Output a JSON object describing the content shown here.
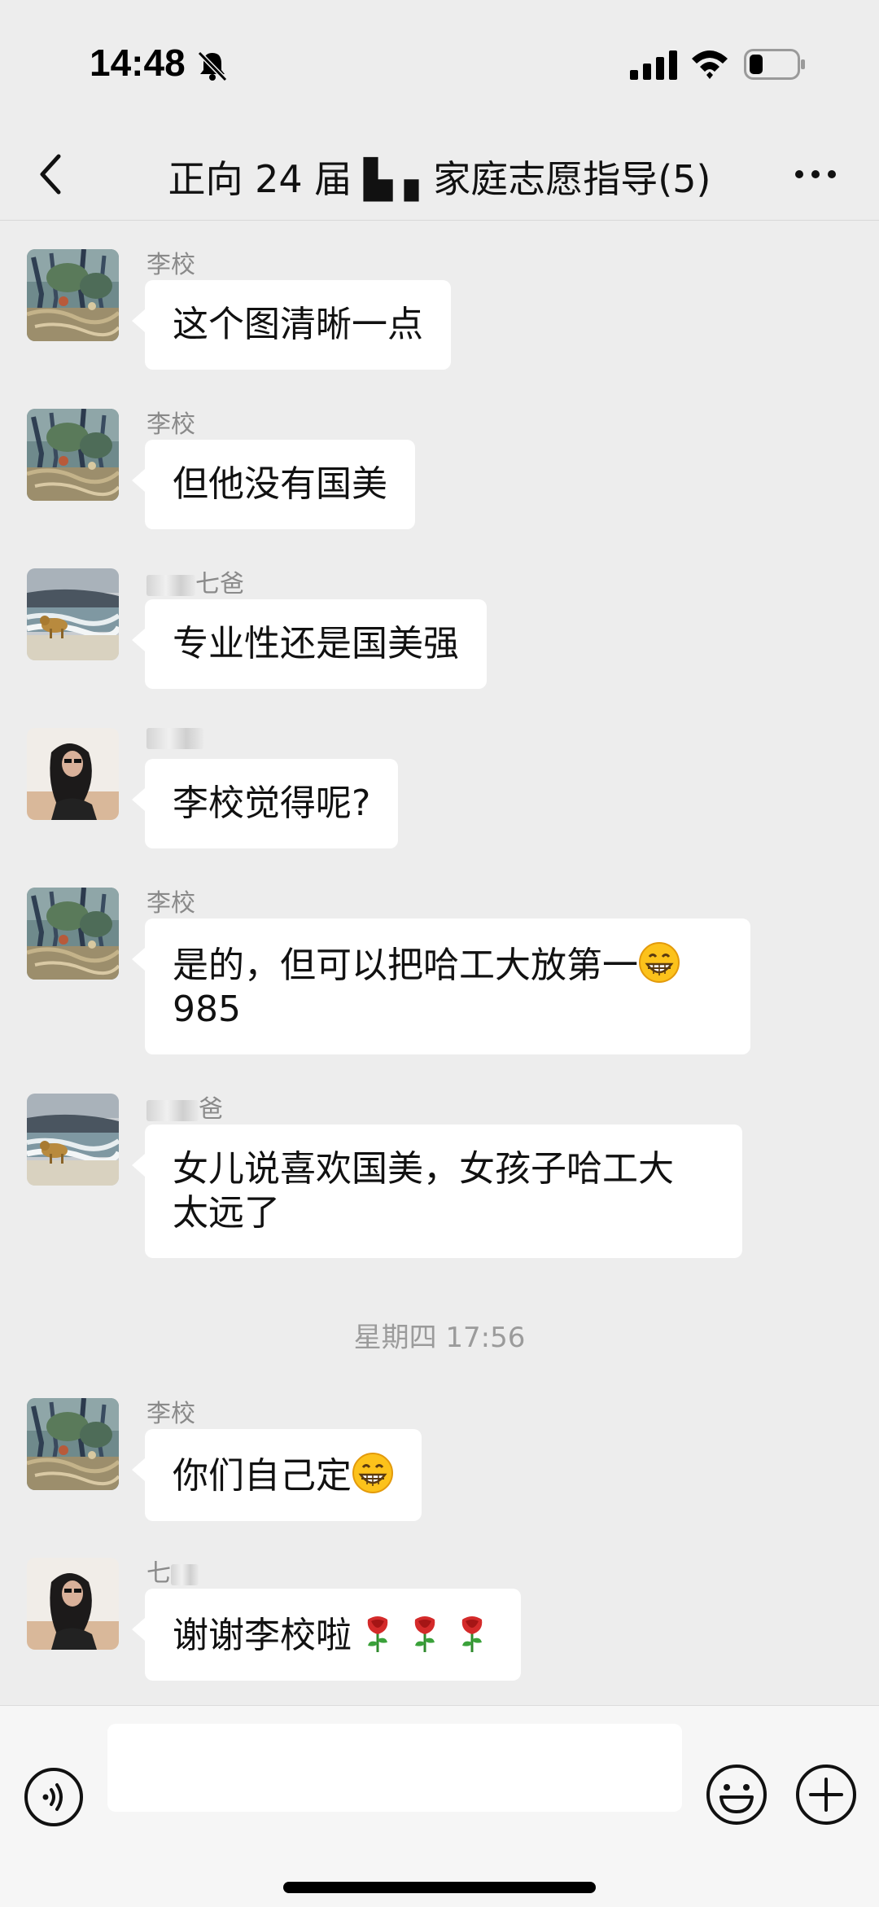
{
  "status_bar": {
    "time": "14:48",
    "icons": [
      "bell-off-icon",
      "signal-icon",
      "wifi-icon",
      "battery-icon"
    ]
  },
  "header": {
    "title": "正向 24 届 ▙ ▖家庭志愿指导(5)",
    "back_icon": "back-icon",
    "more_icon": "more-icon"
  },
  "messages": [
    {
      "sender": "李校",
      "text": "这个图清晰一点",
      "avatar": "painting"
    },
    {
      "sender": "李校",
      "text": "但他没有国美",
      "avatar": "painting"
    },
    {
      "sender": "七爸",
      "text": "专业性还是国美强",
      "avatar": "beach-dog"
    },
    {
      "sender": "",
      "text": "李校觉得呢?",
      "avatar": "woman-portrait"
    },
    {
      "sender": "李校",
      "text": "是的，但可以把哈工大放第一",
      "text2": "985",
      "emoji": "grinning-face",
      "avatar": "painting"
    },
    {
      "sender": "爸",
      "text": "女儿说喜欢国美，女孩子哈工大",
      "text2": "太远了",
      "avatar": "beach-dog"
    },
    {
      "sender": "李校",
      "text": "你们自己定",
      "emoji": "grinning-face",
      "avatar": "painting"
    },
    {
      "sender": "七",
      "text": "谢谢李校啦",
      "emoji": "rose",
      "avatar": "woman-portrait"
    }
  ],
  "time_separator": "星期四 17:56",
  "input_bar": {
    "placeholder": "",
    "icons": [
      "voice-icon",
      "emoji-icon",
      "plus-icon"
    ]
  },
  "colors": {
    "background": "#ededed",
    "bubble": "#ffffff",
    "sender_text": "#8a8a8a"
  }
}
